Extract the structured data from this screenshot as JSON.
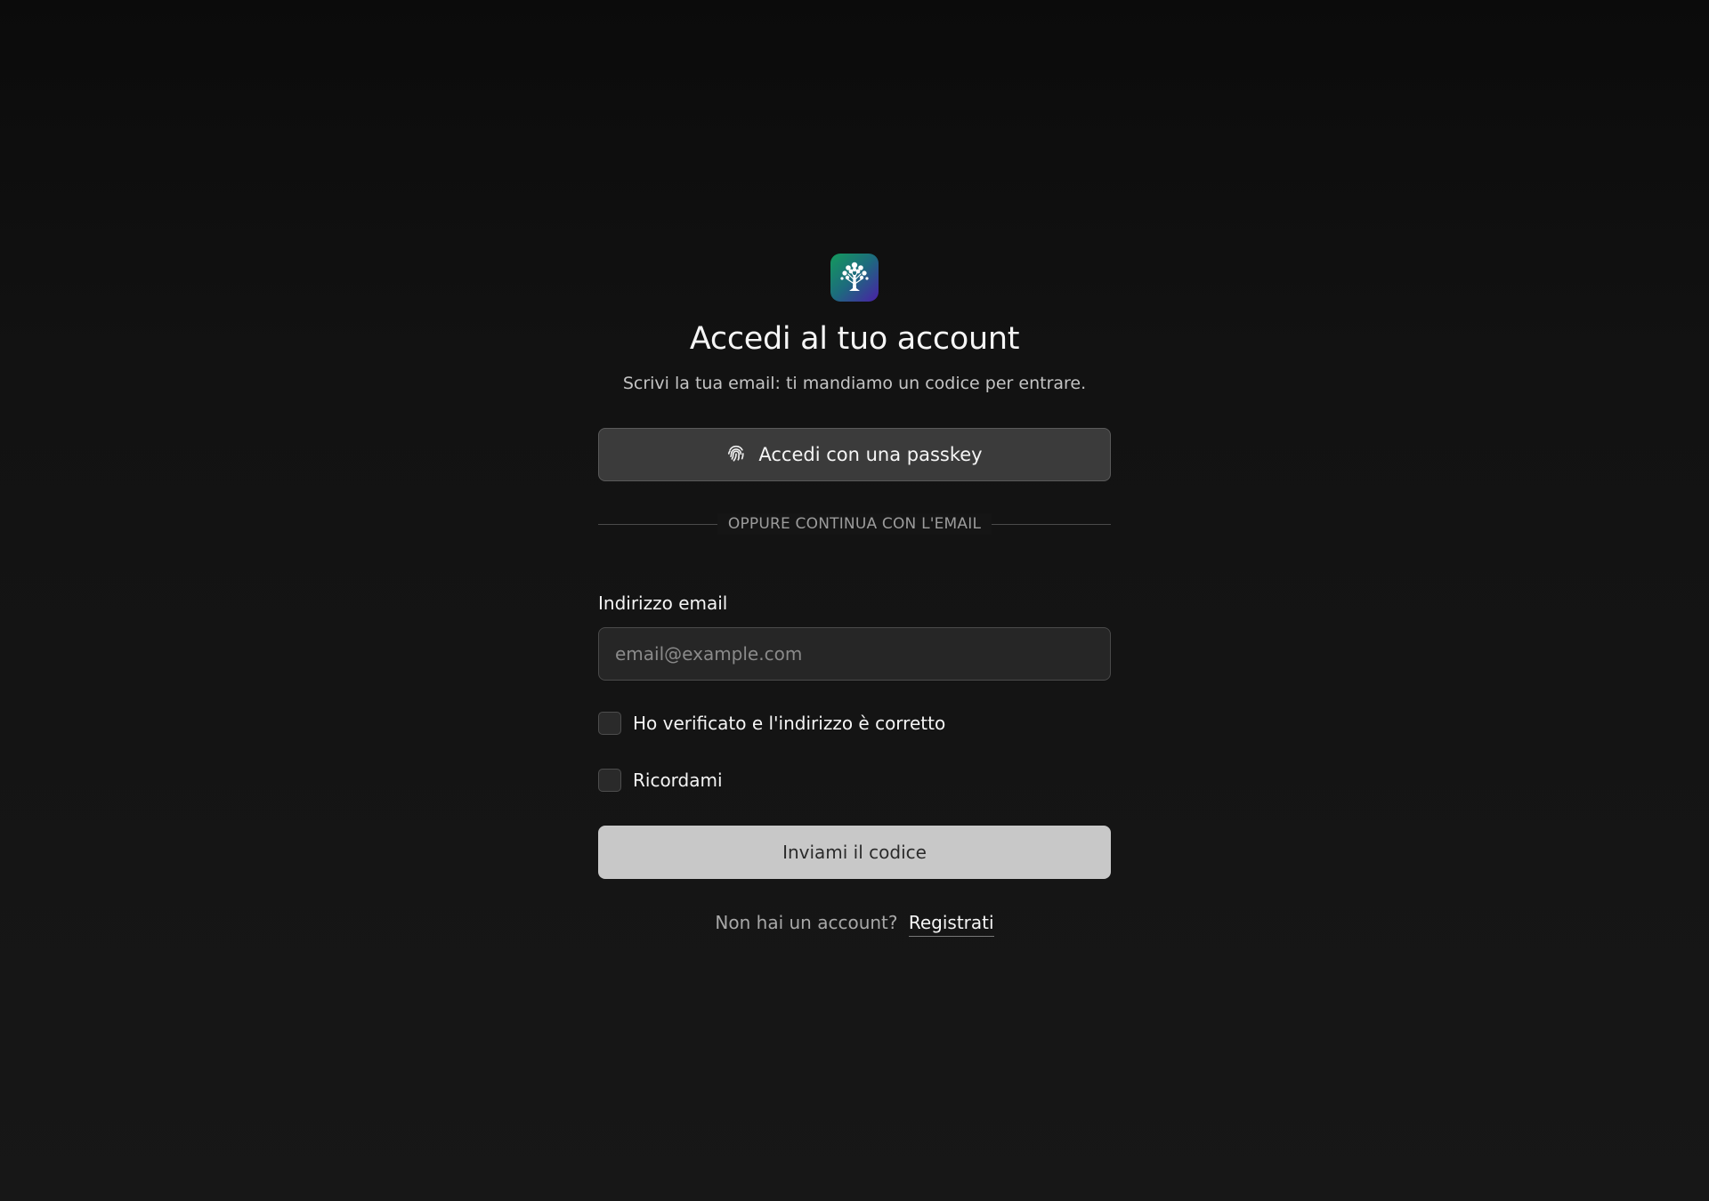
{
  "logo": {
    "icon": "tree-icon",
    "colors": [
      "#149a5c",
      "#4a1fa6"
    ]
  },
  "title": "Accedi al tuo account",
  "subtitle": "Scrivi la tua email: ti mandiamo un codice per entrare.",
  "passkey_button": {
    "label": "Accedi con una passkey",
    "icon": "fingerprint-icon"
  },
  "divider_text": "OPPURE CONTINUA CON L'EMAIL",
  "email": {
    "label": "Indirizzo email",
    "placeholder": "email@example.com",
    "value": ""
  },
  "checkboxes": [
    {
      "label": "Ho verificato e l'indirizzo è corretto",
      "checked": false
    },
    {
      "label": "Ricordami",
      "checked": false
    }
  ],
  "submit_button": {
    "label": "Inviami il codice"
  },
  "signup": {
    "text": "Non hai un account?",
    "link_label": "Registrati"
  }
}
